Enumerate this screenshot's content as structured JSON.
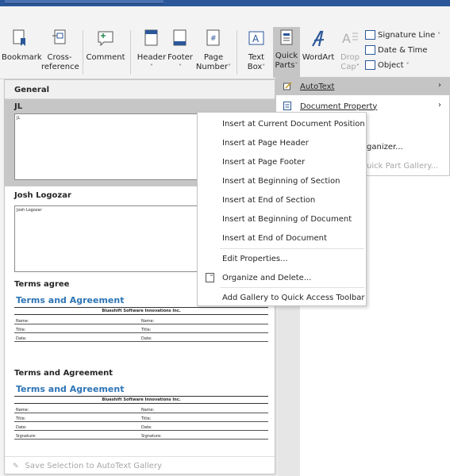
{
  "ribbon": {
    "bookmark": "Bookmark",
    "cross_reference_1": "Cross-",
    "cross_reference_2": "reference",
    "comment": "Comment",
    "header": "Header",
    "footer": "Footer",
    "page_number_1": "Page",
    "page_number_2": "Number",
    "text_box_1": "Text",
    "text_box_2": "Box",
    "quick_parts_1": "Quick",
    "quick_parts_2": "Parts",
    "wordart": "WordArt",
    "drop_cap_1": "Drop",
    "drop_cap_2": "Cap",
    "signature_line": "Signature Line",
    "date_time": "Date & Time",
    "object": "Object"
  },
  "gallery": {
    "header": "General",
    "entries": [
      {
        "title": "JL",
        "preview": "JL"
      },
      {
        "title": "Josh Logozar",
        "preview": "Josh Logozar"
      },
      {
        "title": "Terms agree"
      },
      {
        "title": "Terms and Agreement"
      }
    ],
    "terms": {
      "heading": "Terms and Agreement",
      "company": "Blueshift Software Innovations Inc.",
      "name": "Name:",
      "title": "Title:",
      "date": "Date:",
      "signature": "Signature:"
    },
    "footer": "Save Selection to AutoText Gallery"
  },
  "quick_menu": {
    "autotext": "AutoText",
    "document_property": "Document Property",
    "organizer_partial": "ganizer...",
    "save_gallery_partial": "uick Part Gallery..."
  },
  "context_menu": {
    "items": [
      "Insert at Current Document Position",
      "Insert at Page Header",
      "Insert at Page Footer",
      "Insert at Beginning of Section",
      "Insert at End of Section",
      "Insert at Beginning of Document",
      "Insert at End of Document",
      "Edit Properties...",
      "Organize and Delete...",
      "Add Gallery to Quick Access Toolbar"
    ]
  },
  "colors": {
    "accent": "#2b579a",
    "terms_heading": "#2e74b5",
    "highlight": "#c5c5c5"
  }
}
